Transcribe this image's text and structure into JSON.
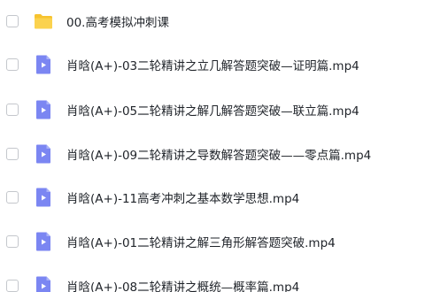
{
  "files": [
    {
      "name": "00.高考模拟冲刺课",
      "icon": "folder-icon"
    },
    {
      "name": "肖晗(A+)-03二轮精讲之立几解答题突破—证明篇.mp4",
      "icon": "video-file-icon"
    },
    {
      "name": "肖晗(A+)-05二轮精讲之解几解答题突破—联立篇.mp4",
      "icon": "video-file-icon"
    },
    {
      "name": "肖晗(A+)-09二轮精讲之导数解答题突破——零点篇.mp4",
      "icon": "video-file-icon"
    },
    {
      "name": "肖晗(A+)-11高考冲刺之基本数学思想.mp4",
      "icon": "video-file-icon"
    },
    {
      "name": "肖晗(A+)-01二轮精讲之解三角形解答题突破.mp4",
      "icon": "video-file-icon"
    },
    {
      "name": "肖晗(A+)-08二轮精讲之概统—概率篇.mp4",
      "icon": "video-file-icon"
    }
  ],
  "colors": {
    "folder": "#f7c32e",
    "video": "#7b86f2",
    "text": "#1f2329",
    "checkbox_border": "#c4c7cc"
  }
}
